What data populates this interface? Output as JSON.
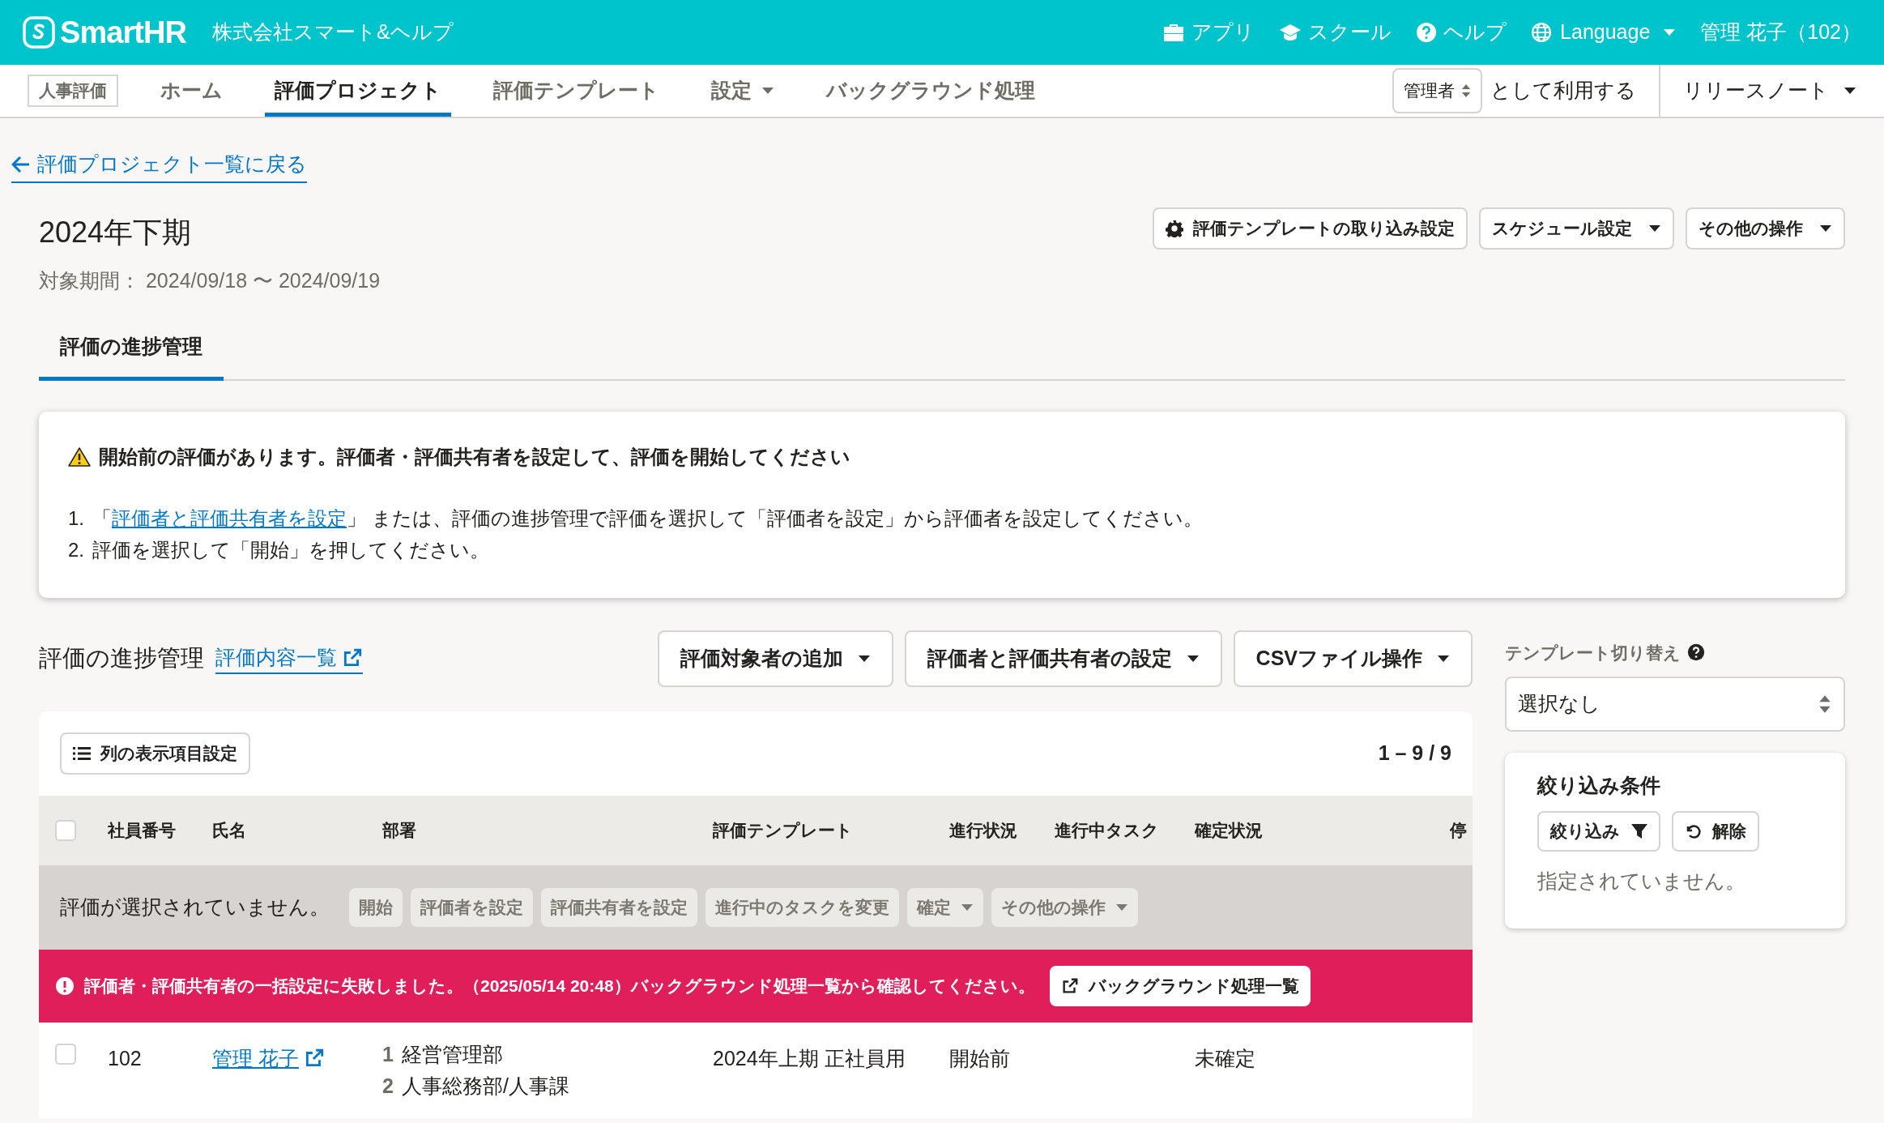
{
  "header": {
    "logo": "SmartHR",
    "company": "株式会社スマート&ヘルプ",
    "links": [
      {
        "kind": "toolbox",
        "label": "アプリ"
      },
      {
        "kind": "cap",
        "label": "スクール"
      },
      {
        "kind": "help",
        "label": "ヘルプ"
      }
    ],
    "language": "Language",
    "user": "管理 花子（102）"
  },
  "nav": {
    "badge": "人事評価",
    "tabs": [
      {
        "label": "ホーム",
        "selected": false,
        "caret": false
      },
      {
        "label": "評価プロジェクト",
        "selected": true,
        "caret": false
      },
      {
        "label": "評価テンプレート",
        "selected": false,
        "caret": false
      },
      {
        "label": "設定",
        "selected": false,
        "caret": true
      },
      {
        "label": "バックグラウンド処理",
        "selected": false,
        "caret": false
      }
    ],
    "role": "管理者",
    "role_suffix": "として利用する",
    "release_notes": "リリースノート"
  },
  "back_link": "評価プロジェクト一覧に戻る",
  "title": "2024年下期",
  "period": "対象期間： 2024/09/18 〜 2024/09/19",
  "actions": [
    {
      "kind": "gear",
      "label": "評価テンプレートの取り込み設定"
    },
    {
      "kind": "dropdown",
      "label": "スケジュール設定"
    },
    {
      "kind": "dropdown",
      "label": "その他の操作"
    }
  ],
  "page_tabs": [
    {
      "label": "評価の進捗管理",
      "selected": true
    }
  ],
  "alert": {
    "title": "開始前の評価があります。評価者・評価共有者を設定して、評価を開始してください",
    "steps": [
      {
        "number": "1.",
        "before": "「",
        "link": "評価者と評価共有者を設定",
        "after": "」 または、評価の進捗管理で評価を選択して「評価者を設定」から評価者を設定してください。"
      },
      {
        "number": "2.",
        "before": "評価を選択して「開始」を押してください。"
      }
    ]
  },
  "section": {
    "title": "評価の進捗管理",
    "link": "評価内容一覧",
    "buttons": [
      "評価対象者の追加",
      "評価者と評価共有者の設定",
      "CSVファイル操作"
    ]
  },
  "table": {
    "column_settings": "列の表示項目設定",
    "count": "1 – 9 / 9",
    "header_checked": false,
    "columns": [
      "社員番号",
      "氏名",
      "部署",
      "評価テンプレート",
      "進行状況",
      "進行中タスク",
      "確定状況",
      "停"
    ],
    "selection": {
      "text": "評価が選択されていません。",
      "actions": [
        {
          "label": "開始",
          "caret": false,
          "disabled": true
        },
        {
          "label": "評価者を設定",
          "caret": false,
          "disabled": true
        },
        {
          "label": "評価共有者を設定",
          "caret": false,
          "disabled": true
        },
        {
          "label": "進行中のタスクを変更",
          "caret": false,
          "disabled": true
        },
        {
          "label": "確定",
          "caret": true,
          "disabled": true
        },
        {
          "label": "その他の操作",
          "caret": true,
          "disabled": true
        }
      ]
    },
    "error": {
      "message": "評価者・評価共有者の一括設定に失敗しました。（2025/05/14 20:48）バックグラウンド処理一覧から確認してください。",
      "button": "バックグラウンド処理一覧"
    },
    "rows": [
      {
        "checked": false,
        "id": "102",
        "name": "管理 花子",
        "departments": [
          {
            "number": "1",
            "name": "経営管理部"
          },
          {
            "number": "2",
            "name": "人事総務部/人事課"
          }
        ],
        "template": "2024年上期 正社員用",
        "status": "開始前",
        "task": "",
        "confirmation": "未確定"
      }
    ]
  },
  "sidebar": {
    "template_label": "テンプレート切り替え",
    "template_value": "選択なし",
    "filter_title": "絞り込み条件",
    "filter_button": "絞り込み",
    "clear_button": "解除",
    "filter_empty": "指定されていません。"
  }
}
